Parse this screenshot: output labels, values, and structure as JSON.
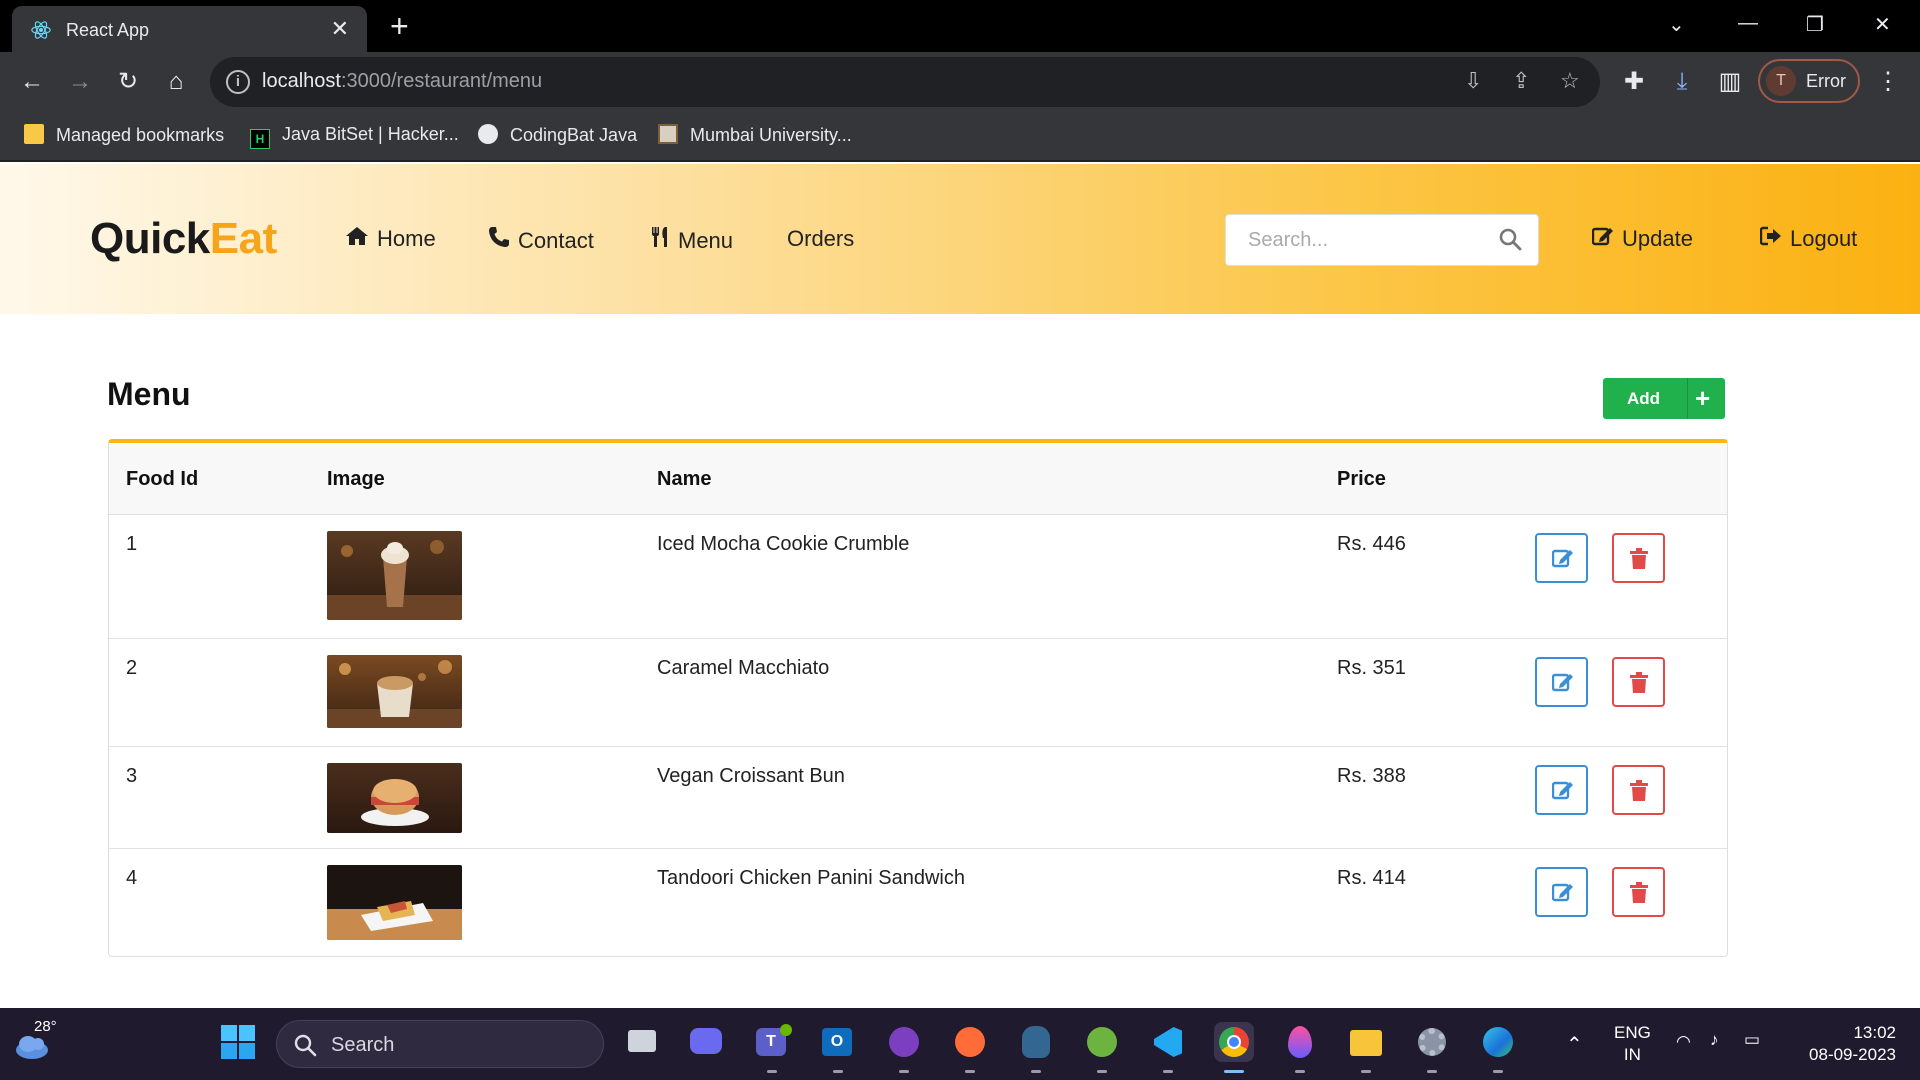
{
  "browser": {
    "tab_title": "React App",
    "url_host": "localhost",
    "url_rest": ":3000/restaurant/menu",
    "profile_initial": "T",
    "profile_status": "Error",
    "bookmarks": [
      {
        "label": "Managed bookmarks",
        "icon": "folder-icon"
      },
      {
        "label": "Java BitSet | Hacker...",
        "icon": "hackerrank-icon"
      },
      {
        "label": "CodingBat Java",
        "icon": "globe-icon"
      },
      {
        "label": "Mumbai University...",
        "icon": "university-icon"
      }
    ]
  },
  "app": {
    "logo_part1": "Quick",
    "logo_part2": "Eat",
    "nav": [
      {
        "label": "Home",
        "icon": "home-icon"
      },
      {
        "label": "Contact",
        "icon": "phone-icon"
      },
      {
        "label": "Menu",
        "icon": "cutlery-icon"
      },
      {
        "label": "Orders",
        "icon": ""
      }
    ],
    "search_placeholder": "Search...",
    "update_label": "Update",
    "logout_label": "Logout",
    "accent": "#f6a51a"
  },
  "page": {
    "title": "Menu",
    "add_label": "Add",
    "add_icon": "plus-icon",
    "table": {
      "headers": [
        "Food Id",
        "Image",
        "Name",
        "Price"
      ],
      "rows": [
        {
          "id": "1",
          "name": "Iced Mocha Cookie Crumble",
          "price": "Rs. 446"
        },
        {
          "id": "2",
          "name": "Caramel Macchiato",
          "price": "Rs. 351"
        },
        {
          "id": "3",
          "name": "Vegan Croissant Bun",
          "price": "Rs. 388"
        },
        {
          "id": "4",
          "name": "Tandoori Chicken Panini Sandwich",
          "price": "Rs. 414"
        }
      ]
    }
  },
  "taskbar": {
    "weather": "28°",
    "search_label": "Search",
    "lang_top": "ENG",
    "lang_bottom": "IN",
    "time": "13:02",
    "date": "08-09-2023"
  }
}
